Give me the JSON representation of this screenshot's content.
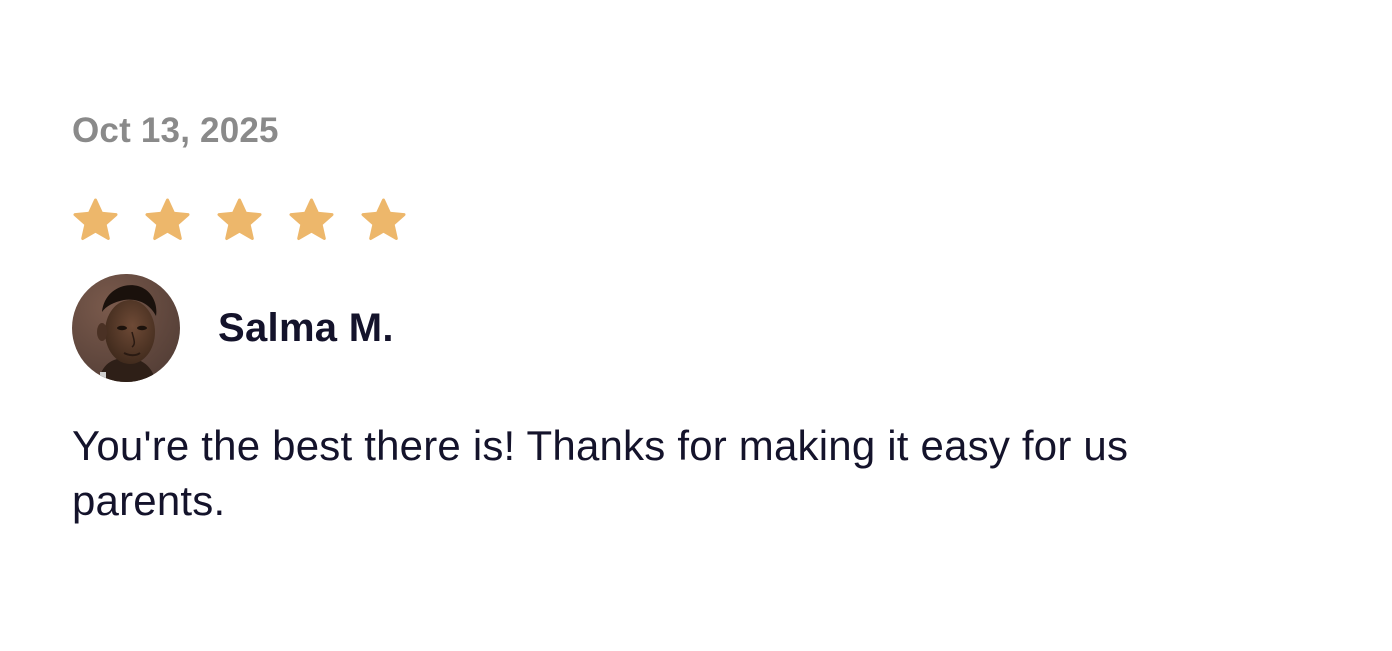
{
  "review": {
    "date": "Oct 13, 2025",
    "rating": 5,
    "rating_max": 5,
    "star_color": "#EDB76B",
    "author_name": "Salma M.",
    "avatar_icon": "avatar",
    "text": "You're the best there is! Thanks for making it easy for us parents."
  }
}
